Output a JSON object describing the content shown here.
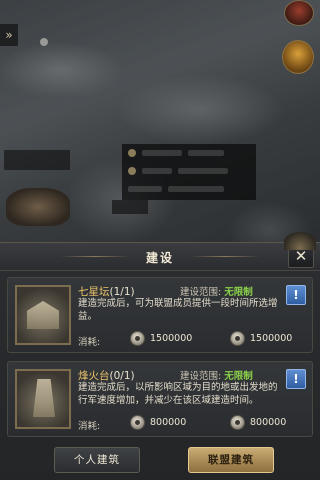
{
  "dialog": {
    "title": "建设",
    "close_label": "✕"
  },
  "buildings": [
    {
      "name": "七星坛",
      "count": "(1/1)",
      "range_label": "建设范围:",
      "range_value": "无限制",
      "description": "建造完成后，可为联盟成员提供一段时间所选增益。",
      "cost_label": "消耗:",
      "cost_a": "1500000",
      "cost_b": "1500000",
      "info_label": "!"
    },
    {
      "name": "烽火台",
      "count": "(0/1)",
      "range_label": "建设范围:",
      "range_value": "无限制",
      "description": "建造完成后，以所影响区域为目的地或出发地的行军速度增加，并减少在该区域建造时间。",
      "cost_label": "消耗:",
      "cost_a": "800000",
      "cost_b": "800000",
      "info_label": "!"
    }
  ],
  "footer": {
    "personal_label": "个人建筑",
    "alliance_label": "联盟建筑"
  },
  "map": {
    "arrow_label": "»"
  }
}
